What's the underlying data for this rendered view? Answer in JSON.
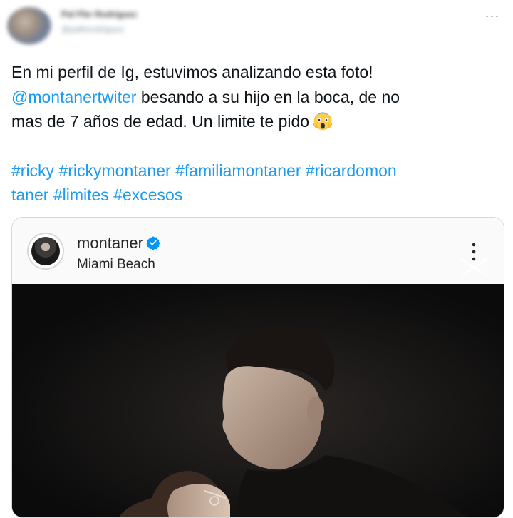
{
  "tweet": {
    "author_name": "Pal Ffer Rodriguez",
    "author_handle": "@palforodriguez",
    "more_label": "···",
    "text_line1": "En mi perfil de Ig, estuvimos analizando esta foto!",
    "mention": "@montanertwiter",
    "text_line2_rest": " besando a su hijo en la boca, de no",
    "text_line3": "mas de 7 años de edad. Un limite te pido",
    "hashtags_line1": "#ricky #rickymontaner #familiamontaner #ricardomon",
    "hashtags_line2": "taner #limites #excesos",
    "emoji": "scream-emoji",
    "link_color": "#1d9bf0"
  },
  "instagram_card": {
    "username": "montaner",
    "location": "Miami Beach",
    "verified": true,
    "verified_color": "#0095f6"
  }
}
